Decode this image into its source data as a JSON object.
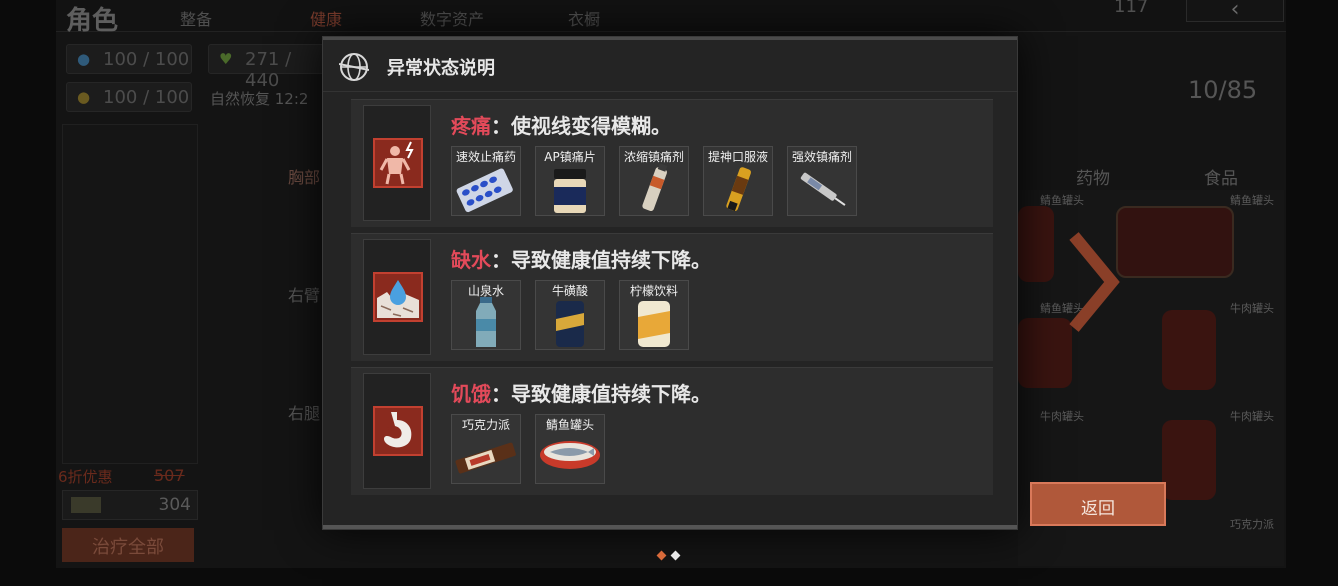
{
  "background": {
    "title": "角色",
    "tabs": [
      {
        "label": "整备",
        "active": false
      },
      {
        "label": "健康",
        "active": true
      },
      {
        "label": "数字资产",
        "active": false
      },
      {
        "label": "衣橱",
        "active": false
      }
    ],
    "top_value": "117",
    "back_arrow": "‹",
    "stats": {
      "water": "100 / 100",
      "food": "100 / 100",
      "health": "271 / 440"
    },
    "natural_recovery_label": "自然恢复 12:2",
    "body_parts": [
      "胸部",
      "右臂",
      "右腿"
    ],
    "discount_label": "6折优惠",
    "original_price": "507",
    "cost": "304",
    "heal_all_label": "治疗全部",
    "inventory_count": "10/85",
    "category_tabs": [
      "药物",
      "食品"
    ],
    "grid_labels": [
      "鲭鱼罐头",
      "鲭鱼罐头",
      "牛肉罐头",
      "牛肉罐头",
      "牛肉罐头",
      "巧克力派",
      "鲭鱼罐头"
    ]
  },
  "modal": {
    "title": "异常状态说明",
    "statuses": [
      {
        "name": "疼痛",
        "description": "：使视线变得模糊。",
        "icon": "pain-figure-icon",
        "items": [
          "速效止痛药",
          "AP镇痛片",
          "浓缩镇痛剂",
          "提神口服液",
          "强效镇痛剂"
        ]
      },
      {
        "name": "缺水",
        "description": "：导致健康值持续下降。",
        "icon": "water-drop-icon",
        "items": [
          "山泉水",
          "牛磺酸",
          "柠檬饮料"
        ]
      },
      {
        "name": "饥饿",
        "description": "：导致健康值持续下降。",
        "icon": "stomach-icon",
        "items": [
          "巧克力派",
          "鲭鱼罐头"
        ]
      }
    ]
  },
  "return_label": "返回",
  "colors": {
    "accent": "#b0583a",
    "status_name": "#e34a5a",
    "modal_bg": "#242424"
  }
}
